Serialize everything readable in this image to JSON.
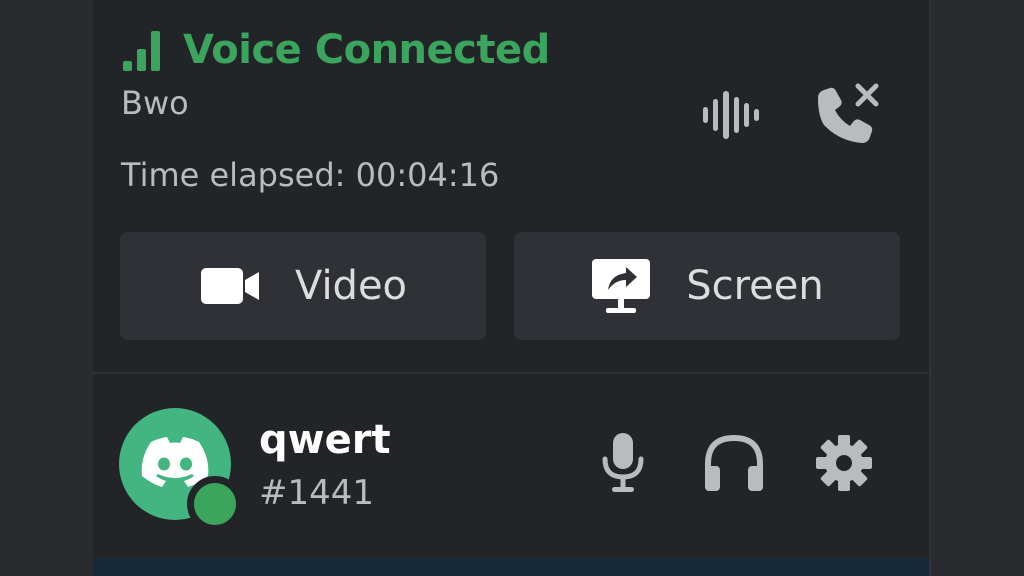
{
  "voice": {
    "status": "Voice Connected",
    "channel": "Bwo",
    "elapsed": "Time elapsed: 00:04:16",
    "signal_icon": "signal-bars-icon",
    "noise_icon": "sound-waveform-icon",
    "disconnect_icon": "phone-disconnect-icon"
  },
  "actions": {
    "video_label": "Video",
    "video_icon": "video-camera-icon",
    "screen_label": "Screen",
    "screen_icon": "screen-share-icon"
  },
  "user": {
    "name": "qwert",
    "discriminator": "#1441",
    "avatar_icon": "discord-logo-icon",
    "mic_icon": "microphone-icon",
    "headset_icon": "headphones-icon",
    "settings_icon": "gear-icon"
  },
  "colors": {
    "background": "#292b2f",
    "panel": "#232428",
    "accent_green": "#3ba55d",
    "avatar_green": "#43b581",
    "text_muted": "#b9bbbe",
    "text_light": "#dcddde",
    "button_bg": "#2f3136",
    "icon_gray": "#b9bbbe"
  }
}
